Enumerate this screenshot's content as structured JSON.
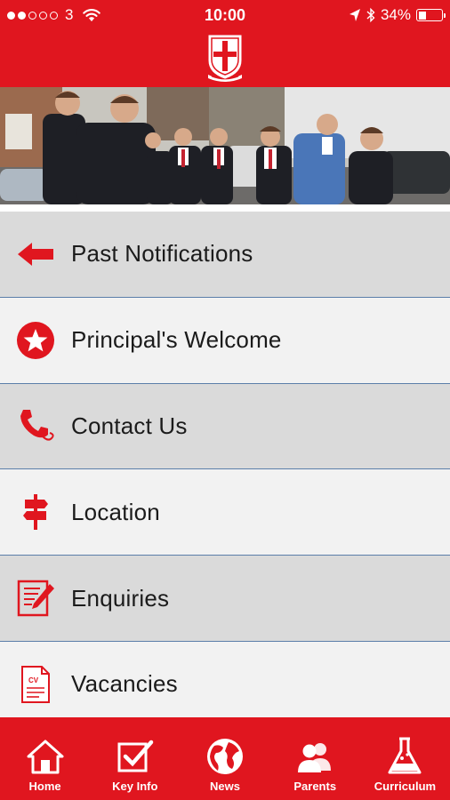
{
  "status_bar": {
    "carrier": "3",
    "time": "10:00",
    "battery_percent": "34%",
    "battery_level": 0.34
  },
  "header": {
    "logo_icon": "school-crest-icon"
  },
  "colors": {
    "brand_red": "#e0161f",
    "separator": "#5b7ea9"
  },
  "menu": [
    {
      "label": "Past Notifications",
      "icon": "arrow-left-icon"
    },
    {
      "label": "Principal's Welcome",
      "icon": "star-circle-icon"
    },
    {
      "label": "Contact Us",
      "icon": "phone-icon"
    },
    {
      "label": "Location",
      "icon": "signpost-icon"
    },
    {
      "label": "Enquiries",
      "icon": "document-pencil-icon"
    },
    {
      "label": "Vacancies",
      "icon": "cv-document-icon"
    }
  ],
  "tabs": [
    {
      "label": "Home",
      "icon": "home-icon",
      "active": true
    },
    {
      "label": "Key Info",
      "icon": "checkbox-icon",
      "active": false
    },
    {
      "label": "News",
      "icon": "globe-icon",
      "active": false
    },
    {
      "label": "Parents",
      "icon": "people-icon",
      "active": false
    },
    {
      "label": "Curriculum",
      "icon": "flask-icon",
      "active": false
    }
  ]
}
